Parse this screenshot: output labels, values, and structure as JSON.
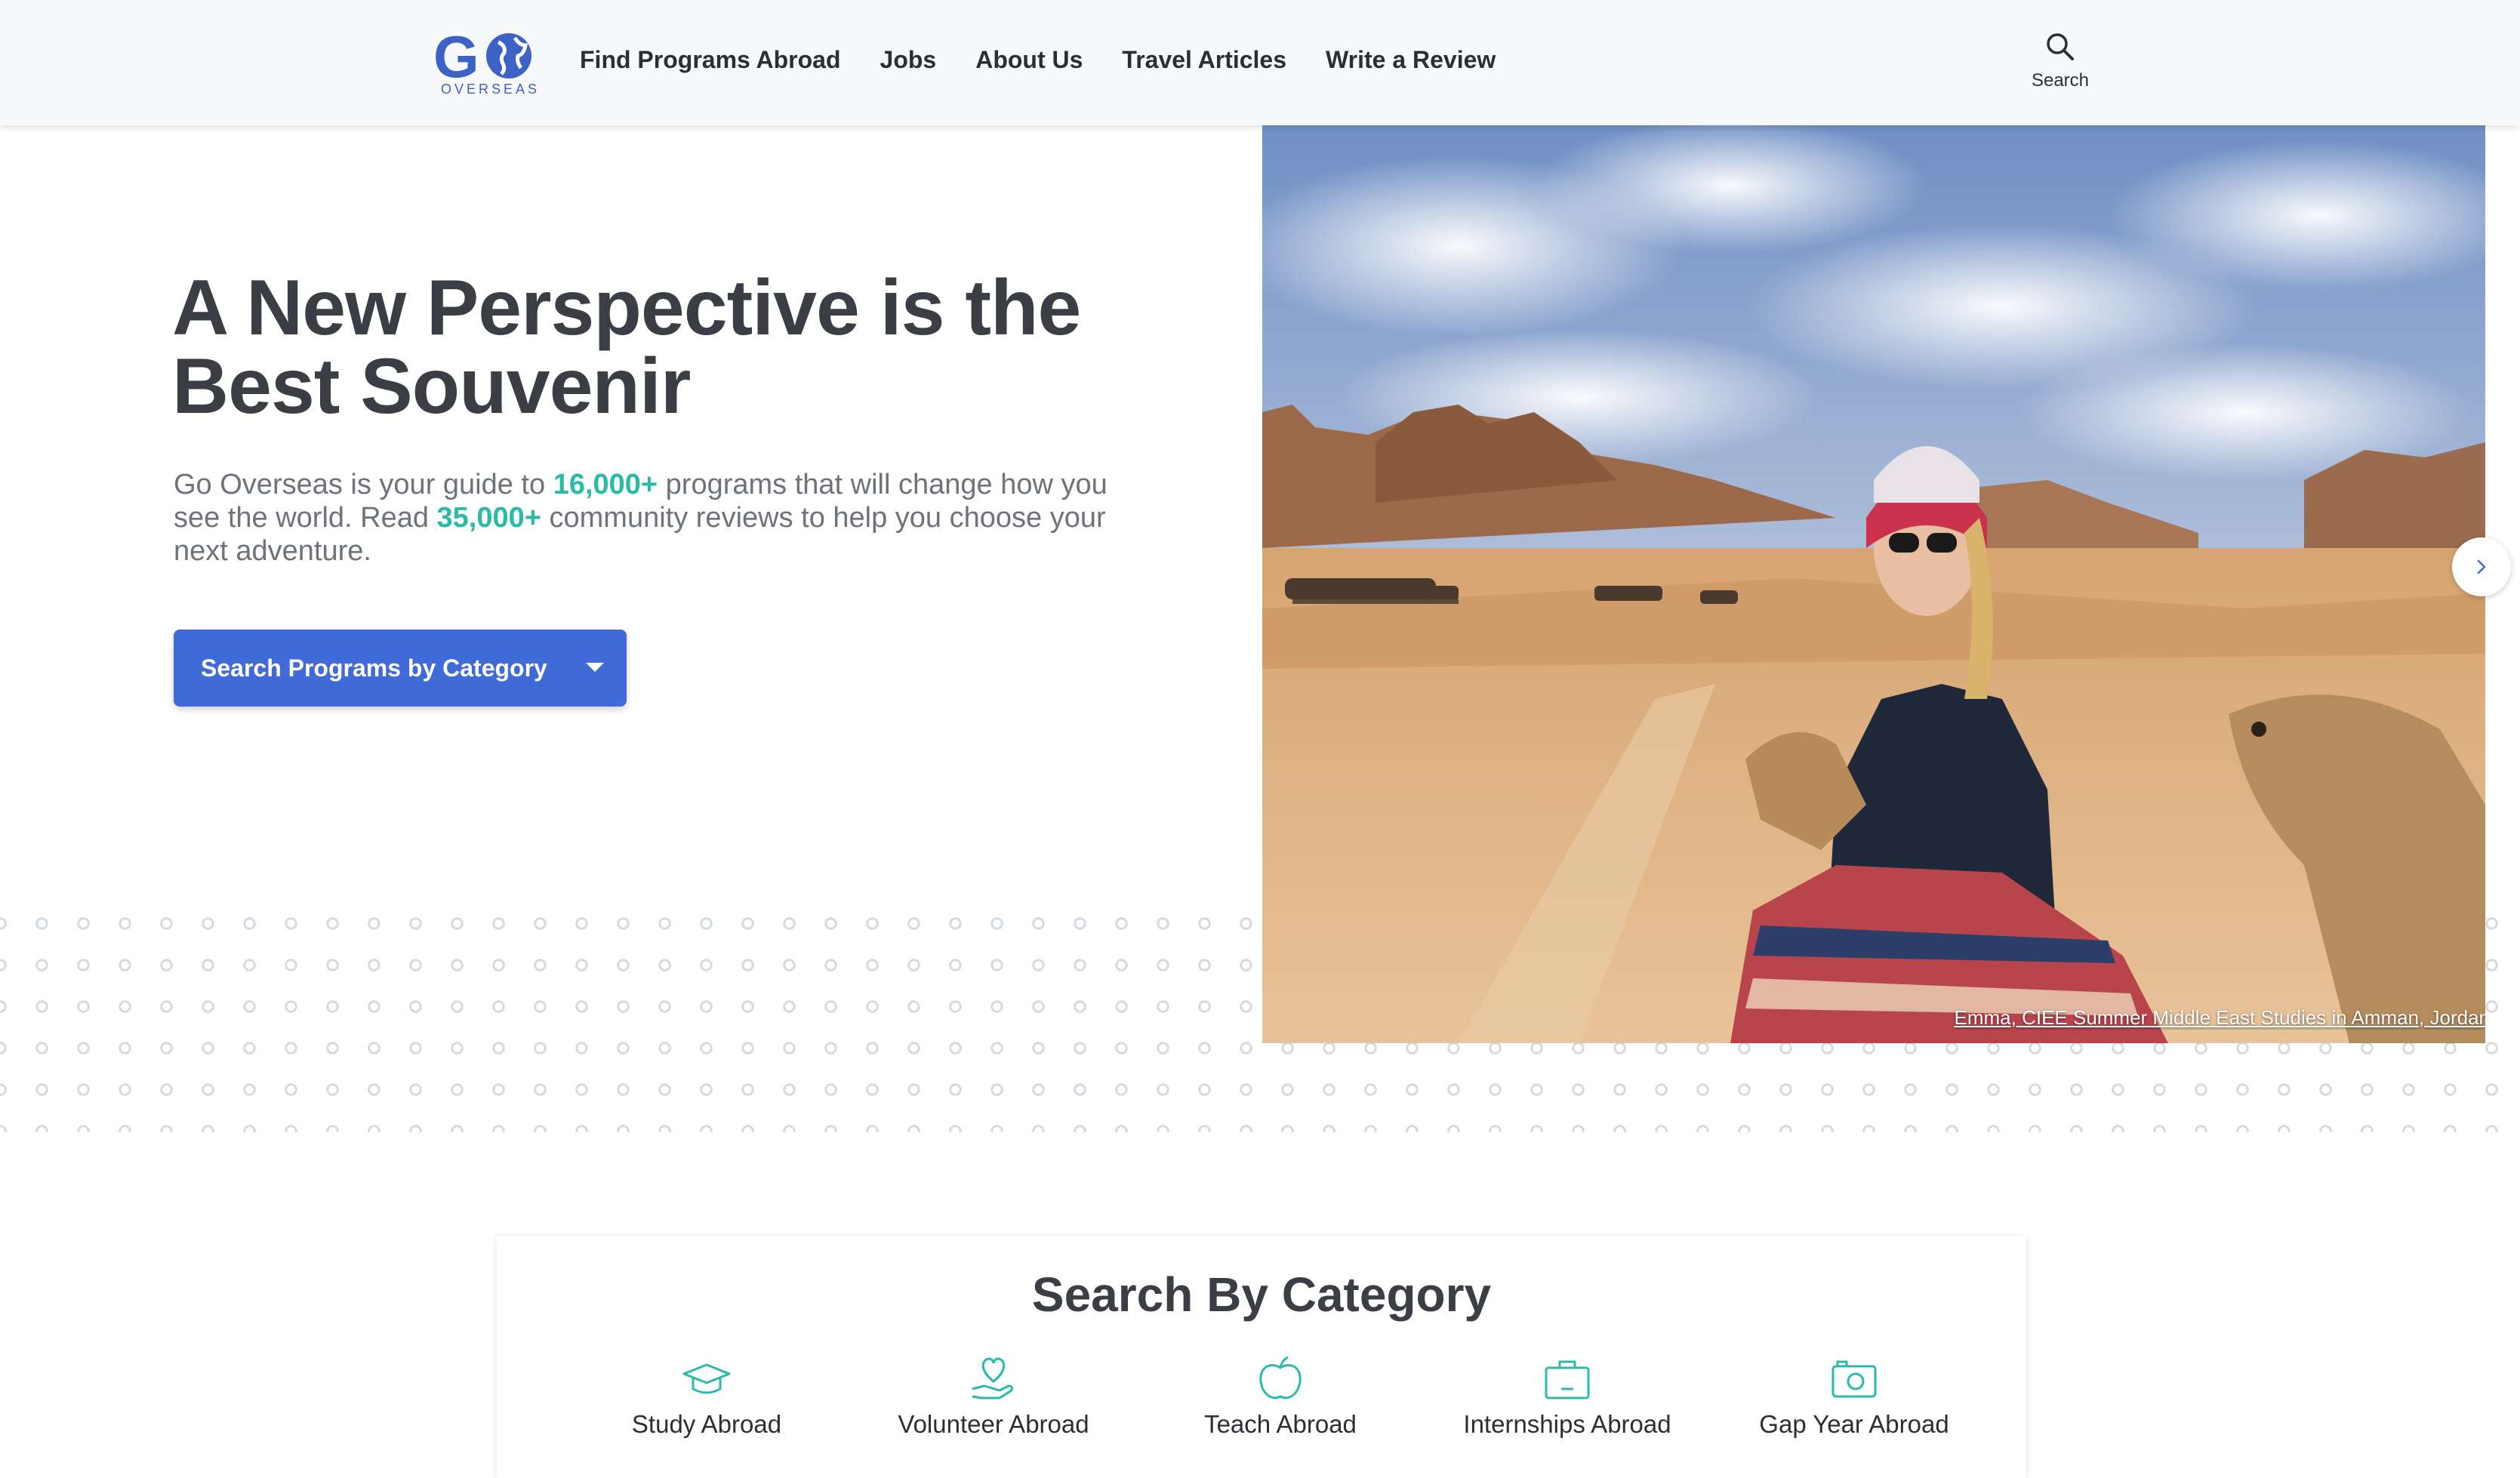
{
  "header": {
    "logo_text": "GO",
    "logo_sub": "OVERSEAS",
    "nav": [
      {
        "label": "Find Programs Abroad"
      },
      {
        "label": "Jobs"
      },
      {
        "label": "About Us"
      },
      {
        "label": "Travel Articles"
      },
      {
        "label": "Write a Review"
      }
    ],
    "search_label": "Search"
  },
  "hero": {
    "title": "A New Perspective is the Best Souvenir",
    "text_1": "Go Overseas is your guide to ",
    "count_programs": "16,000+",
    "text_2": " programs that will change how you see the world. Read ",
    "count_reviews": "35,000+",
    "text_3": " community reviews to help you choose your next adventure.",
    "cta_label": "Search Programs by Category",
    "image_caption": "Emma, CIEE Summer Middle East Studies in Amman, Jordan"
  },
  "categories": {
    "title": "Search By Category",
    "items": [
      {
        "label": "Study Abroad",
        "icon": "graduation-cap-icon"
      },
      {
        "label": "Volunteer Abroad",
        "icon": "heart-hand-icon"
      },
      {
        "label": "Teach Abroad",
        "icon": "apple-icon"
      },
      {
        "label": "Internships Abroad",
        "icon": "briefcase-icon"
      },
      {
        "label": "Gap Year Abroad",
        "icon": "camera-icon"
      }
    ]
  },
  "colors": {
    "brand_blue": "#3f6ad8",
    "accent_teal": "#2bb9a8",
    "heading": "#3b3e45"
  }
}
